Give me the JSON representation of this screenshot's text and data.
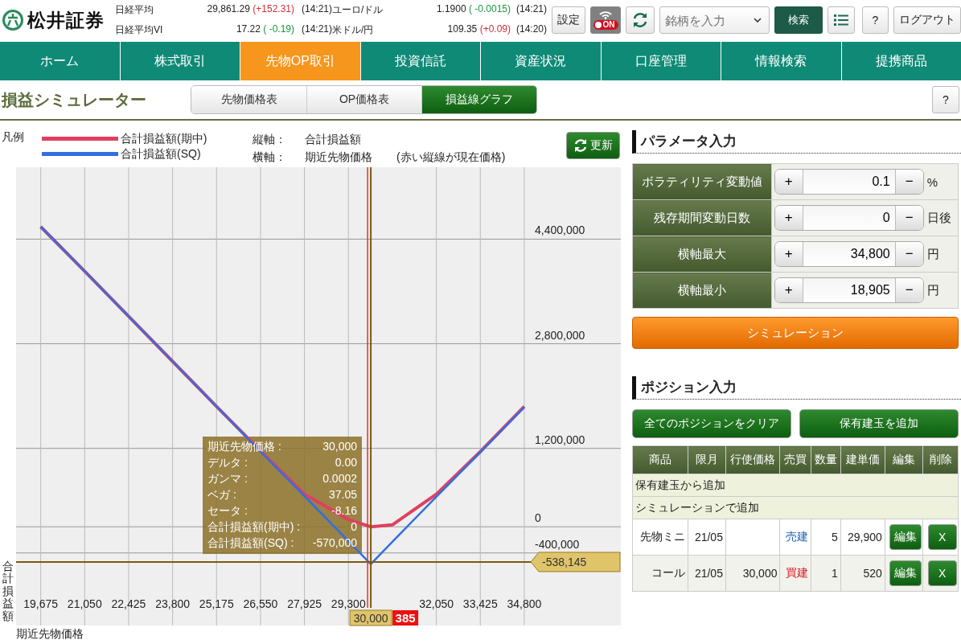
{
  "header": {
    "logo": "松井証券",
    "tickers": [
      {
        "name": "日経平均",
        "value": "29,861.29",
        "change": "(+152.31)",
        "color": "#d0303a",
        "time": "(14:21)"
      },
      {
        "name": "ユーロ/ドル",
        "value": "1.1900",
        "change": "( -0.0015)",
        "color": "#1a9a3a",
        "time": "(14:21)"
      },
      {
        "name": "日経平均VI",
        "value": "17.22",
        "change": "( -0.19)",
        "color": "#1a9a3a",
        "time": "(14:21)"
      },
      {
        "name": "米ドル/円",
        "value": "109.35",
        "change": "(+0.09)",
        "color": "#d0303a",
        "time": "(14:20)"
      }
    ],
    "settings_button": "設定",
    "wifi_toggle": {
      "label": "ON",
      "on": true
    },
    "search": {
      "placeholder": "銘柄を入力"
    },
    "search_button": "検索",
    "help_button": "?",
    "logout_button": "ログアウト"
  },
  "nav": [
    {
      "label": "ホーム",
      "selected": false
    },
    {
      "label": "株式取引",
      "selected": false
    },
    {
      "label": "先物OP取引",
      "selected": true
    },
    {
      "label": "投資信託",
      "selected": false
    },
    {
      "label": "資産状況",
      "selected": false
    },
    {
      "label": "口座管理",
      "selected": false
    },
    {
      "label": "情報検索",
      "selected": false
    },
    {
      "label": "提携商品",
      "selected": false
    }
  ],
  "page_title": "損益シミュレーター",
  "view_tabs": [
    {
      "label": "先物価格表",
      "selected": false
    },
    {
      "label": "OP価格表",
      "selected": false
    },
    {
      "label": "損益線グラフ",
      "selected": true
    }
  ],
  "page_help_button": "?",
  "legend": {
    "title": "凡例"
  },
  "axes_info": [
    {
      "label": "縦軸：",
      "value": "合計損益額"
    },
    {
      "label": "横軸：",
      "value": "期近先物価格",
      "note": "(赤い縦線が現在価格)"
    }
  ],
  "refresh_button": "更新",
  "chart": {
    "chart_data": {
      "type": "line",
      "xlabel": "期近先物価格",
      "ylabel": "合計損益額",
      "grid": true,
      "x": [
        19675,
        21050,
        22425,
        23800,
        25175,
        26550,
        27925,
        29300,
        30000,
        30675,
        32050,
        33425,
        34800
      ],
      "series": [
        {
          "name": "合計損益額(期中)",
          "color": "#e0405e",
          "values": [
            4590000,
            3910000,
            3220000,
            2530000,
            1840000,
            1160000,
            500000,
            110000,
            0,
            30000,
            500000,
            1150000,
            1840000
          ]
        },
        {
          "name": "合計損益額(SQ)",
          "color": "#3070e0",
          "values": [
            4590000,
            3910000,
            3220000,
            2530000,
            1840000,
            1150000,
            470000,
            -220000,
            -570000,
            -230000,
            460000,
            1140000,
            1830000
          ]
        }
      ],
      "xlim": [
        18905,
        37820
      ],
      "ylim": [
        -1510000,
        5500000
      ],
      "xticks": [
        {
          "value": 19675,
          "label": "19,675"
        },
        {
          "value": 21050,
          "label": "21,050"
        },
        {
          "value": 22425,
          "label": "22,425"
        },
        {
          "value": 23800,
          "label": "23,800"
        },
        {
          "value": 25175,
          "label": "25,175"
        },
        {
          "value": 26550,
          "label": "26,550"
        },
        {
          "value": 27925,
          "label": "27,925"
        },
        {
          "value": 29300,
          "label": "29,300"
        },
        {
          "value": 32050,
          "label": "32,050"
        },
        {
          "value": 33425,
          "label": "33,425"
        },
        {
          "value": 34800,
          "label": "34,800"
        }
      ],
      "yticks": [
        {
          "value": 4400000,
          "label": "4,400,000"
        },
        {
          "value": 2800000,
          "label": "2,800,000"
        },
        {
          "value": 1200000,
          "label": "1,200,000"
        },
        {
          "value": 0,
          "label": "0"
        },
        {
          "value": -400000,
          "label": "-400,000"
        }
      ],
      "ref_lines": [
        {
          "axis": "x",
          "value": 30000,
          "color": "#7a5a10"
        },
        {
          "axis": "y",
          "value": -538145,
          "color": "#7a5a10"
        },
        {
          "axis": "x",
          "value": 29900,
          "color": "#e23030"
        }
      ]
    },
    "crosshair": {
      "x_label": "30,000",
      "y_label": "-538,145"
    },
    "current_price_label": "385",
    "tooltip": [
      {
        "label": "期近先物価格 :",
        "value": "30,000"
      },
      {
        "label": "デルタ :",
        "value": "0.00"
      },
      {
        "label": "ガンマ :",
        "value": "0.0002"
      },
      {
        "label": "ベガ :",
        "value": "37.05"
      },
      {
        "label": "セータ :",
        "value": "-8.16"
      },
      {
        "label": "合計損益額(期中) :",
        "value": "0"
      },
      {
        "label": "合計損益額(SQ) :",
        "value": "-570,000"
      }
    ]
  },
  "parameters": {
    "title": "パラメータ入力",
    "rows": [
      {
        "label": "ボラティリティ変動値",
        "plus": "+",
        "value": "0.1",
        "minus": "−",
        "unit": "%"
      },
      {
        "label": "残存期間変動日数",
        "plus": "+",
        "value": "0",
        "minus": "−",
        "unit": "日後"
      },
      {
        "label": "横軸最大",
        "plus": "+",
        "value": "34,800",
        "minus": "−",
        "unit": "円"
      },
      {
        "label": "横軸最小",
        "plus": "+",
        "value": "18,905",
        "minus": "−",
        "unit": "円"
      }
    ],
    "simulate_button": "シミュレーション"
  },
  "positions": {
    "title": "ポジション入力",
    "buttons": [
      "全てのポジションをクリア",
      "保有建玉を追加"
    ],
    "columns": [
      "商品",
      "限月",
      "行使価格",
      "売買",
      "数量",
      "建単価",
      "編集",
      "削除"
    ],
    "group_rows": [
      "保有建玉から追加",
      "シミュレーションで追加"
    ],
    "rows": [
      {
        "product": "先物ミニ",
        "month": "21/05",
        "side": "売建",
        "color": "#1a5fb4",
        "qty": "5",
        "price": "29,900",
        "edit": "編集",
        "delete": "X"
      },
      {
        "product": "コール",
        "month": "21/05",
        "strike": "30,000",
        "side": "買建",
        "color": "#e0101a",
        "qty": "1",
        "price": "520",
        "edit": "編集",
        "delete": "X"
      }
    ]
  }
}
